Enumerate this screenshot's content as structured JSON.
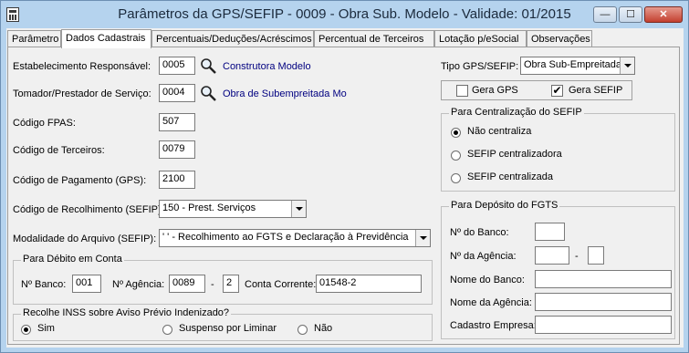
{
  "window": {
    "title": "Parâmetros da GPS/SEFIP - 0009 - Obra Sub. Modelo - Validade: 01/2015"
  },
  "tabs": [
    {
      "label": "Parâmetro"
    },
    {
      "label": "Dados Cadastrais"
    },
    {
      "label": "Percentuais/Deduções/Acréscimos"
    },
    {
      "label": "Percentual de Terceiros"
    },
    {
      "label": "Lotação p/eSocial"
    },
    {
      "label": "Observações"
    }
  ],
  "form": {
    "estab": {
      "label": "Estabelecimento Responsável:",
      "value": "0005",
      "link": "Construtora Modelo"
    },
    "tomador": {
      "label": "Tomador/Prestador de Serviço:",
      "value": "0004",
      "link": "Obra de Subempreitada Mo"
    },
    "fpas": {
      "label": "Código FPAS:",
      "value": "507"
    },
    "terceiros": {
      "label": "Código de Terceiros:",
      "value": "0079"
    },
    "pagamento": {
      "label": "Código de Pagamento (GPS):",
      "value": "2100"
    },
    "recolhimento": {
      "label": "Código de Recolhimento (SEFIP):",
      "value": "150 - Prest. Serviços"
    },
    "modalidade": {
      "label": "Modalidade do Arquivo (SEFIP):",
      "value": "' ' - Recolhimento ao FGTS e Declaração à Previdência"
    }
  },
  "debito": {
    "title": "Para Débito em Conta",
    "banco_label": "Nº Banco:",
    "banco": "001",
    "agencia_label": "Nº Agência:",
    "agencia": "0089",
    "dash": "-",
    "agencia_dv": "2",
    "conta_label": "Conta Corrente:",
    "conta": "01548-2"
  },
  "inss": {
    "title": "Recolhe INSS sobre Aviso Prévio Indenizado?",
    "options": [
      "Sim",
      "Suspenso por Liminar",
      "Não"
    ],
    "selected": "Sim"
  },
  "tipo": {
    "label": "Tipo GPS/SEFIP:",
    "value": "Obra Sub-Empreitada",
    "gera_gps": "Gera GPS",
    "gera_gps_checked": false,
    "gera_sefip": "Gera SEFIP",
    "gera_sefip_checked": true
  },
  "centralizacao": {
    "title": "Para Centralização do SEFIP",
    "options": [
      "Não centraliza",
      "SEFIP centralizadora",
      "SEFIP centralizada"
    ],
    "selected": "Não centraliza"
  },
  "fgts": {
    "title": "Para Depósito do FGTS",
    "banco": "Nº do Banco:",
    "agencia": "Nº da Agência:",
    "dash": "-",
    "nome_banco": "Nome do Banco:",
    "nome_agencia": "Nome da Agência:",
    "cadastro": "Cadastro Empresa:"
  },
  "window_buttons": {
    "min": "—",
    "max": "☐",
    "close": "✕"
  }
}
